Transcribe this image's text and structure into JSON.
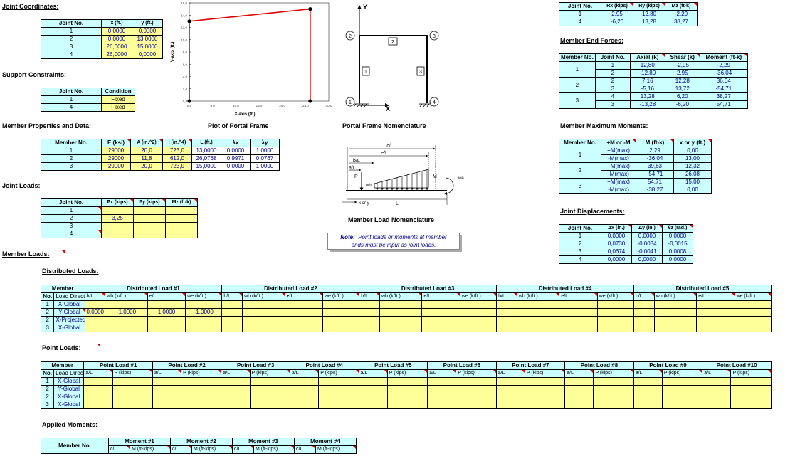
{
  "titles": {
    "joint_coordinates": "Joint Coordinates:",
    "support_constraints": "Support Constraints:",
    "member_properties": "Member Properties and Data:",
    "joint_loads": "Joint Loads:",
    "member_loads": "Member Loads:",
    "distributed_loads": "Distributed Loads:",
    "point_loads": "Point Loads:",
    "applied_moments": "Applied Moments:",
    "plot_portal_frame": "Plot of Portal Frame",
    "portal_nomenclature": "Portal Frame Nomenclature",
    "member_load_nomenclature": "Member Load Nomenclature",
    "member_end_forces": "Member End Forces:",
    "member_max_moments": "Member Maximum Moments:",
    "joint_displacements": "Joint Displacements:"
  },
  "joint_coords": {
    "headers": [
      "Joint No.",
      "x (ft.)",
      "y (ft.)"
    ],
    "rows": [
      [
        "1",
        "0,0000",
        "0,0000"
      ],
      [
        "2",
        "0,0000",
        "13,0000"
      ],
      [
        "3",
        "26,0000",
        "15,0000"
      ],
      [
        "4",
        "26,0000",
        "0,0000"
      ]
    ]
  },
  "supports": {
    "headers": [
      "Joint No.",
      "Condition"
    ],
    "rows": [
      [
        "1",
        "Fixed"
      ],
      [
        "4",
        "Fixed"
      ]
    ]
  },
  "member_props": {
    "headers": [
      "Member No.",
      "E (ksi)",
      "A (in.^2)",
      "I (in.^4)",
      "L (ft.)",
      "λx",
      "λy"
    ],
    "rows": [
      [
        "1",
        "29000",
        "20,0",
        "723,0",
        "13,0000",
        "0,0000",
        "1,0000"
      ],
      [
        "2",
        "29000",
        "11,8",
        "612,0",
        "26,0768",
        "0,9971",
        "0,0767"
      ],
      [
        "3",
        "29000",
        "20,0",
        "723,0",
        "15,0000",
        "0,0000",
        "1,0000"
      ]
    ]
  },
  "joint_loads": {
    "headers": [
      "Joint No.",
      "Px (kips)",
      "Py (kips)",
      "Mz (ft-k)"
    ],
    "rows": [
      [
        "1",
        "",
        "",
        ""
      ],
      [
        "2",
        "3,25",
        "",
        ""
      ],
      [
        "3",
        "",
        "",
        ""
      ],
      [
        "4",
        "",
        "",
        ""
      ]
    ]
  },
  "dist_loads": {
    "member_header": "Member",
    "no_label": "No.",
    "dir_label": "Load Direct.",
    "group_headers": [
      "Distributed Load #1",
      "Distributed Load #2",
      "Distributed Load #3",
      "Distributed Load #4",
      "Distributed Load #5"
    ],
    "sub_headers": [
      "b/L",
      "wb (k/ft.)",
      "e/L",
      "we (k/ft.)"
    ],
    "rows": [
      {
        "no": "1",
        "dir": "X-Global",
        "vals": [
          "",
          "",
          "",
          ""
        ]
      },
      {
        "no": "2",
        "dir": "Y-Global",
        "vals": [
          "0,0000",
          "-1,0000",
          "1,0000",
          "-1,0000"
        ]
      },
      {
        "no": "2",
        "dir": "X-Projected",
        "vals": [
          "",
          "",
          "",
          ""
        ]
      },
      {
        "no": "3",
        "dir": "X-Global",
        "vals": [
          "",
          "",
          "",
          ""
        ]
      }
    ]
  },
  "point_loads": {
    "member_header": "Member",
    "no_label": "No.",
    "dir_label": "Load Direct.",
    "group_headers": [
      "Point Load #1",
      "Point Load #2",
      "Point Load #3",
      "Point Load #4",
      "Point Load #5",
      "Point Load #6",
      "Point Load #7",
      "Point Load #8",
      "Point Load #9",
      "Point Load #10"
    ],
    "sub_headers": [
      "a/L",
      "P (kips)"
    ],
    "rows": [
      {
        "no": "1",
        "dir": "X-Global"
      },
      {
        "no": "2",
        "dir": "Y-Global"
      },
      {
        "no": "2",
        "dir": "X-Global"
      },
      {
        "no": "3",
        "dir": "X-Global"
      }
    ]
  },
  "moments": {
    "member_header": "Member No.",
    "group_headers": [
      "Moment #1",
      "Moment #2",
      "Moment #3",
      "Moment #4"
    ],
    "sub_headers": [
      "c/L",
      "M (ft-kips)"
    ]
  },
  "reactions": {
    "headers": [
      "Joint No.",
      "Rx (kips)",
      "Ry (kips)",
      "Mz (ft-k)"
    ],
    "rows": [
      [
        "1",
        "2,95",
        "12,80",
        "-2,29"
      ],
      [
        "4",
        "-6,20",
        "13,28",
        "38,27"
      ]
    ]
  },
  "end_forces": {
    "headers": [
      "Member No.",
      "Joint No.",
      "Axial (k)",
      "Shear (k)",
      "Moment (ft-k)"
    ],
    "rows": [
      [
        "1",
        "1",
        "12,80",
        "-2,95",
        "-2,29"
      ],
      [
        "",
        "2",
        "-12,80",
        "2,95",
        "-36,04"
      ],
      [
        "2",
        "2",
        "7,16",
        "12,28",
        "36,04"
      ],
      [
        "",
        "3",
        "-5,16",
        "13,72",
        "-54,71"
      ],
      [
        "3",
        "4",
        "13,28",
        "6,20",
        "38,27"
      ],
      [
        "",
        "3",
        "-13,28",
        "-6,20",
        "54,71"
      ]
    ]
  },
  "max_moments": {
    "headers": [
      "Member No.",
      "+M or -M",
      "M (ft-k)",
      "x or y (ft.)"
    ],
    "rows": [
      [
        "1",
        "+M(max)",
        "2,29",
        "0,00"
      ],
      [
        "",
        "-M(max)",
        "-36,04",
        "13,00"
      ],
      [
        "2",
        "+M(max)",
        "39,63",
        "12,32"
      ],
      [
        "",
        "-M(max)",
        "-54,71",
        "26,08"
      ],
      [
        "3",
        "+M(max)",
        "54,71",
        "15,00"
      ],
      [
        "",
        "-M(max)",
        "-38,27",
        "0,00"
      ]
    ]
  },
  "displacements": {
    "headers": [
      "Joint No.",
      "Δx (in.)",
      "Δy (in.)",
      "θz (rad.)"
    ],
    "rows": [
      [
        "1",
        "0,0000",
        "0,0000",
        "0,0000"
      ],
      [
        "2",
        "0,0730",
        "-0,0034",
        "-0,0015"
      ],
      [
        "3",
        "0,0674",
        "-0,0041",
        "0,0008"
      ],
      [
        "4",
        "0,0000",
        "0,0000",
        "0,0000"
      ]
    ]
  },
  "note": {
    "label": "Note:",
    "line1": "Point loads or moments at member",
    "line2": "ends must be input as joint loads."
  },
  "plot": {
    "y_label": "Y-axis (ft.)",
    "x_label": "X-axis (ft.)",
    "y_ticks": [
      "0,0",
      "2,0",
      "4,0",
      "6,0",
      "8,0",
      "10,0",
      "12,0",
      "14,0",
      "16,0"
    ],
    "x_ticks": [
      "0,0",
      "5,0",
      "10,0",
      "15,0",
      "20,0",
      "25,0",
      "30,0"
    ],
    "line_color": "#e00000"
  },
  "nomenclature": {
    "axis_y": "Y",
    "axis_x": "X",
    "joints": [
      "1",
      "2",
      "3",
      "4"
    ],
    "members": [
      "1",
      "2",
      "3"
    ],
    "load_labels": {
      "cL": "c/L",
      "eL": "e/L",
      "bL": "b/L",
      "aL": "a/L",
      "P": "P",
      "wb": "wb",
      "we": "we",
      "M": "M",
      "xy": "x or y",
      "L": "L"
    }
  }
}
